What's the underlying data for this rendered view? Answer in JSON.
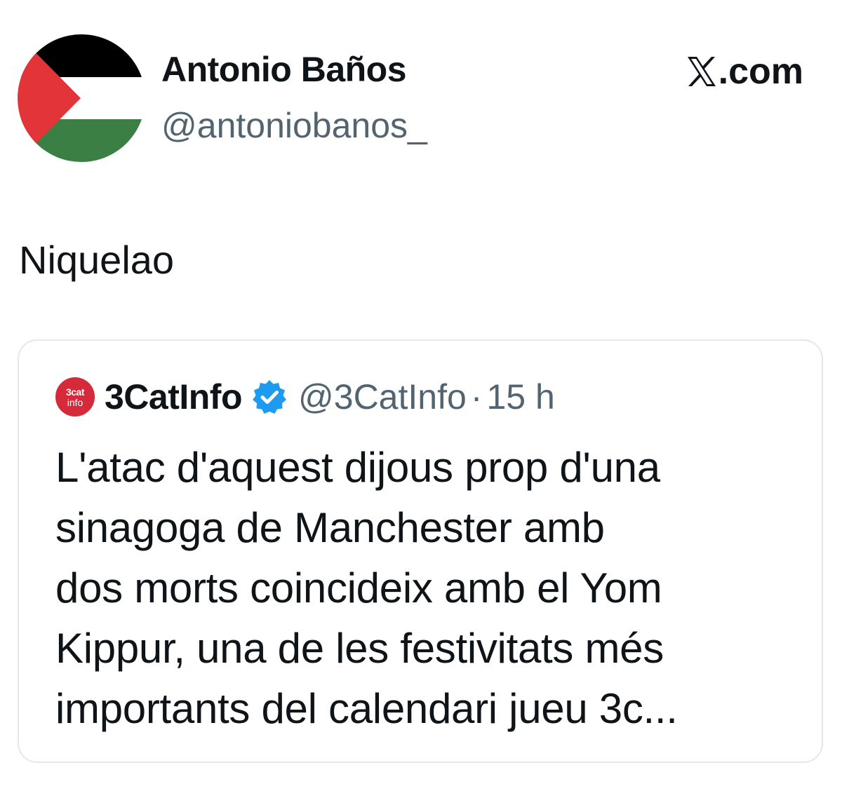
{
  "tweet": {
    "author": {
      "name": "Antonio Baños",
      "handle": "@antoniobanos_",
      "avatar_icon": "palestine-flag-icon"
    },
    "brand": {
      "icon": "x-logo-icon",
      "text": ".com"
    },
    "text": "Niquelao",
    "quoted": {
      "avatar": {
        "top": "3cat",
        "bottom": "info",
        "color": "#d42a3a"
      },
      "name": "3CatInfo",
      "verified_icon": "verified-badge-icon",
      "verified_color": "#1d9bf0",
      "handle": "@3CatInfo",
      "separator": "·",
      "time": "15 h",
      "lines": [
        "L'atac d'aquest dijous prop d'una",
        "sinagoga de Manchester amb",
        "dos morts coincideix amb el Yom",
        "Kippur, una de les festivitats més",
        "importants del calendari jueu 3c..."
      ]
    }
  }
}
